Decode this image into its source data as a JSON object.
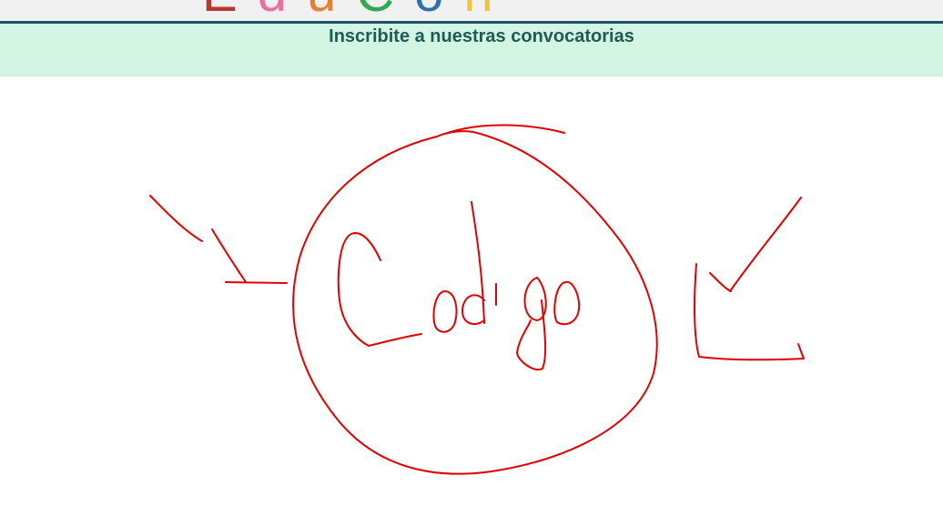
{
  "header": {
    "logo_letters": [
      {
        "char": "E",
        "color": "#b53a2e"
      },
      {
        "char": "d",
        "color": "#ea6fa0"
      },
      {
        "char": "u",
        "color": "#ea7f2b"
      },
      {
        "char": "C",
        "color": "#33a853"
      },
      {
        "char": "o",
        "color": "#2e71ad"
      },
      {
        "char": "n",
        "color": "#f0c33b"
      }
    ]
  },
  "banner": {
    "title": "Inscribite a nuestras convocatorias"
  },
  "annotation": {
    "handwritten_text": "Codigo",
    "stroke_color": "#e30000"
  }
}
